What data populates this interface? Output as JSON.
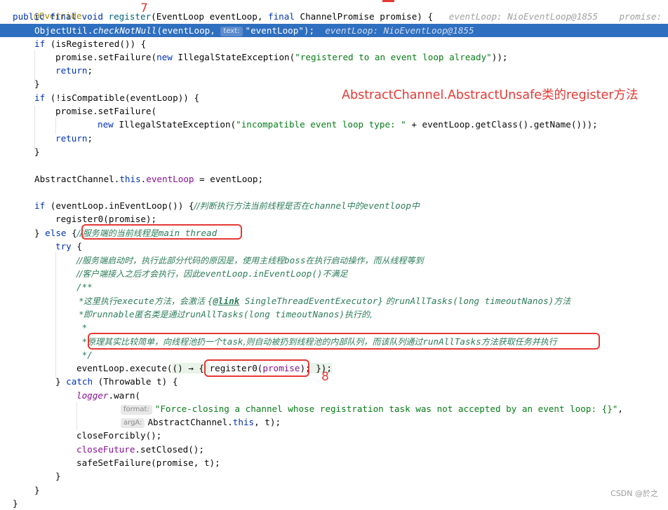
{
  "code": {
    "l0": "@Override",
    "l1": {
      "kw1": "public final void",
      "fn": "register",
      "rest_a": "(EventLoop eventLoop, ",
      "kw2": "final",
      "rest_b": " ChannelPromise promise) {",
      "hint1": "eventLoop: NioEventLoop@1855",
      "hint2": "promise: \"De"
    },
    "l2": {
      "a": "ObjectUtil.",
      "b": "checkNotNull",
      "c": "(eventLoop, ",
      "param": "text:",
      "d": "\"eventLoop\");",
      "hint": "eventLoop: NioEventLoop@1855"
    },
    "l3": {
      "kw": "if",
      "rest": " (isRegistered()) {"
    },
    "l4": {
      "a": "promise.setFailure(",
      "kw": "new",
      "b": " IllegalStateException(",
      "str": "\"registered to an event loop already\"",
      "c": "));"
    },
    "l5": {
      "kw": "return",
      "rest": ";"
    },
    "l6": "}",
    "l7": {
      "kw": "if",
      "rest": " (!isCompatible(eventLoop)) {"
    },
    "l8": "promise.setFailure(",
    "l9": {
      "kw": "new",
      "a": " IllegalStateException(",
      "str": "\"incompatible event loop type: \"",
      "b": " + eventLoop.getClass().getName()));"
    },
    "l10": {
      "kw": "return",
      "rest": ";"
    },
    "l11": "}",
    "l13": {
      "a": "AbstractChannel.",
      "kw": "this",
      "b": ".",
      "fld": "eventLoop",
      "c": " = eventLoop;"
    },
    "l15": {
      "kw": "if",
      "a": " (eventLoop.inEventLoop()) {",
      "cmt_a": "//判断执行方法当前线程是否在",
      "cmt_b": "channel",
      "cmt_c": "中的",
      "cmt_d": "eventloop",
      "cmt_e": "中"
    },
    "l16": "register0(promise);",
    "l17": {
      "a": "} ",
      "kw": "else",
      "b": " {",
      "cmt_a": "//服务端的当前线程是",
      "cmt_b": "main thread"
    },
    "l18": {
      "kw": "try",
      "rest": " {"
    },
    "l19": {
      "cmt_a": "//服务端启动时，执行此部分代码的原因是，使用主线程",
      "cmt_b": "boss",
      "cmt_c": "在执行启动操作，而从线程等到"
    },
    "l20": {
      "cmt_a": "//客户端接入之后才会执行，因此",
      "cmt_b": "eventLoop.inEventLoop()",
      "cmt_c": "不满足"
    },
    "l21": "/**",
    "l22": {
      "a": " *这里执行",
      "b": "execute",
      "c": "方法，会激活 ",
      "d": "{",
      "tag": "@link",
      "e": " SingleThreadEventExecutor}",
      "f": " 的",
      "g": "runAllTasks(long timeoutNanos)",
      "h": "方法"
    },
    "l23": {
      "a": " *即",
      "b": "runnable",
      "c": "匿名类是通过",
      "d": "runAllTasks(long timeoutNanos)",
      "e": "执行的,"
    },
    "l24": " *",
    "l25": {
      "a": " *",
      "b": "原理其实比较简单，向线程池扔一个",
      "c": "task",
      "d": ",则自动被扔到线程池的内部队列，而该队列通过",
      "e": "runAllTasks",
      "f": "方法获取任务并执行"
    },
    "l26": " */",
    "l27": {
      "a": "eventLoop.execute(",
      "b": "() → { ",
      "c": "register0(",
      "d": "promise",
      "e": ");",
      "f": " });"
    },
    "l28": {
      "a": "} ",
      "kw": "catch",
      "b": " (Throwable t) {"
    },
    "l29": {
      "fld": "logger",
      "a": ".warn("
    },
    "l30": {
      "param": "format:",
      "str": "\"Force-closing a channel whose registration task was not accepted by an event loop: {}\"",
      "a": ","
    },
    "l31": {
      "param": "argA:",
      "a": "AbstractChannel.",
      "kw": "this",
      "b": ", t);"
    },
    "l32": "closeForcibly();",
    "l33": {
      "fld": "closeFuture",
      "a": ".setClosed();"
    },
    "l34": "safeSetFailure(promise, t);",
    "l35": "}",
    "l36": "}",
    "l37": "}"
  },
  "annotations": {
    "title": "AbstractChannel.AbstractUnsafe类的register方法",
    "step7": "7",
    "step8": "8"
  },
  "watermark": "CSDN @於之",
  "colors": {
    "keyword": "#0033b3",
    "string": "#067d17",
    "comment": "#2e7d5b",
    "highlight_line": "#2f6fbf",
    "annotation_red": "#e53935"
  }
}
